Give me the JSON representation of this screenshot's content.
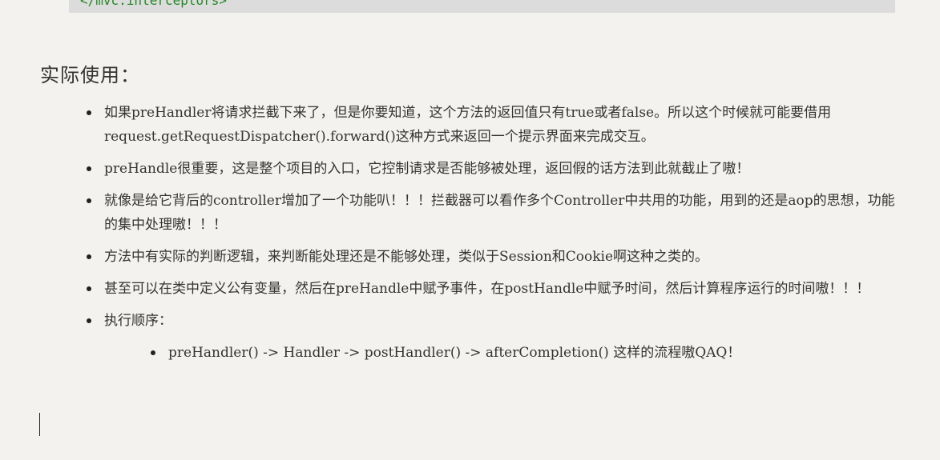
{
  "code_block": {
    "line": "</mvc:interceptors>"
  },
  "heading": "实际使用：",
  "items": [
    "如果preHandler将请求拦截下来了，但是你要知道，这个方法的返回值只有true或者false。所以这个时候就可能要借用request.getRequestDispatcher().forward()这种方式来返回一个提示界面来完成交互。",
    "preHandle很重要，这是整个项目的入口，它控制请求是否能够被处理，返回假的话方法到此就截止了嗷！",
    "就像是给它背后的controller增加了一个功能叭！！！拦截器可以看作多个Controller中共用的功能，用到的还是aop的思想，功能的集中处理嗷！！！",
    "方法中有实际的判断逻辑，来判断能处理还是不能够处理，类似于Session和Cookie啊这种之类的。",
    "甚至可以在类中定义公有变量，然后在preHandle中赋予事件，在postHandle中赋予时间，然后计算程序运行的时间嗷！！！",
    "执行顺序："
  ],
  "sub_items": [
    "preHandler() -> Handler -> postHandler() -> afterCompletion() 这样的流程嗷QAQ！"
  ]
}
